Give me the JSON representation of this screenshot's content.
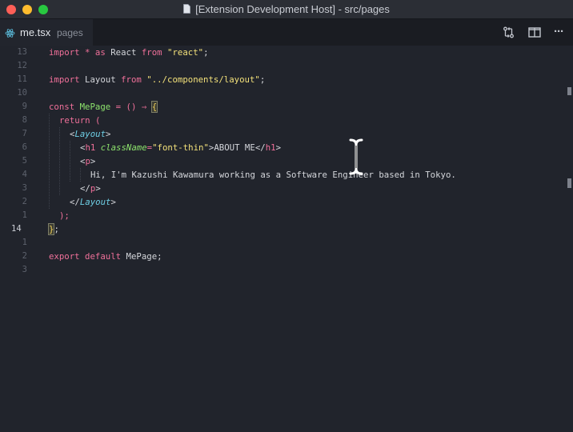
{
  "window": {
    "title": "[Extension Development Host] - src/pages"
  },
  "tab": {
    "file_name": "me.tsx",
    "description": "pages"
  },
  "actions": {
    "icons": [
      "git-compare-icon",
      "split-editor-icon",
      "more-icon"
    ],
    "more_label": "···"
  },
  "editor": {
    "line_numbers": [
      "13",
      "12",
      "11",
      "10",
      "9",
      "8",
      "7",
      "6",
      "5",
      "4",
      "3",
      "2",
      "1",
      "14",
      "1",
      "2",
      "3"
    ],
    "active_line_number": "14",
    "lines": {
      "l1": {
        "a": "import",
        "b": " * ",
        "c": "as",
        "d": " React ",
        "e": "from",
        "f": " ",
        "g": "\"react\"",
        "h": ";"
      },
      "l3": {
        "a": "import",
        "b": " Layout ",
        "c": "from",
        "d": " ",
        "e": "\"../components/layout\"",
        "f": ";"
      },
      "l5": {
        "a": "const",
        "b": " ",
        "c": "MePage",
        "d": " = () ",
        "e": "⇒",
        "f": " ",
        "g": "{"
      },
      "l6": {
        "a": "return",
        "b": " ("
      },
      "l7": {
        "a": "<",
        "b": "Layout",
        "c": ">"
      },
      "l8": {
        "a": "<",
        "b": "h1",
        "c": " ",
        "d": "className",
        "e": "=",
        "f": "\"font-thin\"",
        "g": ">",
        "h": "ABOUT ME",
        "i": "</",
        "j": "h1",
        "k": ">"
      },
      "l9": {
        "a": "<",
        "b": "p",
        "c": ">"
      },
      "l10": {
        "a": "Hi, I'm Kazushi Kawamura working as a Software Engineer based in Tokyo."
      },
      "l11": {
        "a": "</",
        "b": "p",
        "c": ">"
      },
      "l12": {
        "a": "</",
        "b": "Layout",
        "c": ">"
      },
      "l13": {
        "a": ");"
      },
      "l14": {
        "a": "}",
        "b": ";"
      },
      "l16": {
        "a": "export",
        "b": " ",
        "c": "default",
        "d": " MePage;"
      }
    }
  },
  "colors": {
    "keyword": "#f0709a",
    "string": "#f3e17a",
    "function": "#8ee46d",
    "tag": "#6fd0e6",
    "background": "#21242c"
  }
}
